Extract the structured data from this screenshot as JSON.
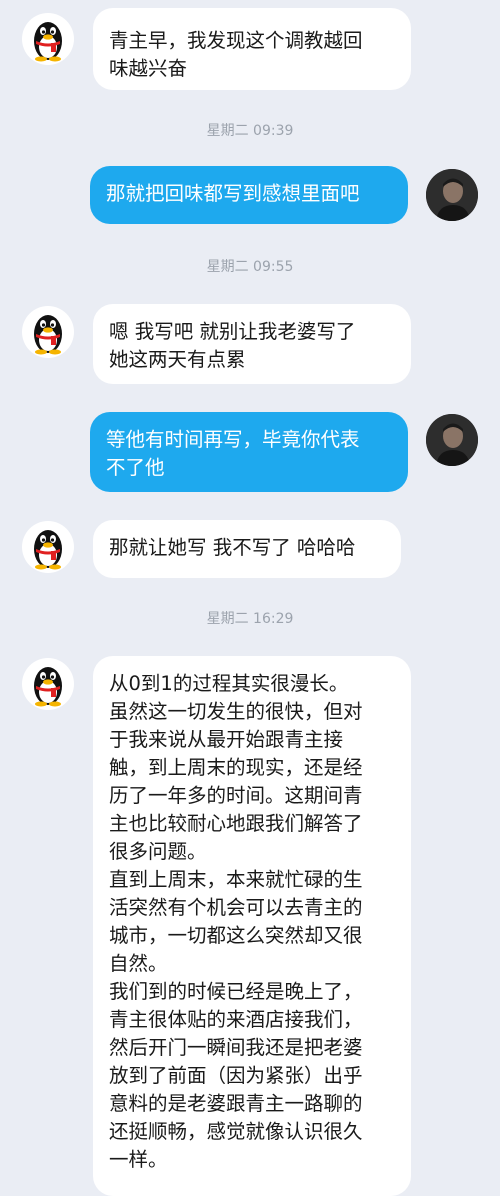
{
  "colors": {
    "background": "#eaedf4",
    "incoming_bubble": "#ffffff",
    "outgoing_bubble": "#1ea9ee",
    "timestamp": "#9ca3ad"
  },
  "messages": [
    {
      "type": "msg",
      "dir": "in",
      "avatar": "qq-penguin-icon",
      "lines": [
        "青主早，我发现这个调教越回",
        "味越兴奋"
      ]
    },
    {
      "type": "ts",
      "text": "星期二 09:39"
    },
    {
      "type": "msg",
      "dir": "out",
      "avatar": "user-avatar",
      "lines": [
        "那就把回味都写到感想里面吧"
      ]
    },
    {
      "type": "ts",
      "text": "星期二 09:55"
    },
    {
      "type": "msg",
      "dir": "in",
      "avatar": "qq-penguin-icon",
      "lines": [
        "嗯 我写吧 就别让我老婆写了",
        "她这两天有点累"
      ]
    },
    {
      "type": "msg",
      "dir": "out",
      "avatar": "user-avatar",
      "lines": [
        "等他有时间再写，毕竟你代表",
        "不了他"
      ]
    },
    {
      "type": "msg",
      "dir": "in",
      "avatar": "qq-penguin-icon",
      "lines": [
        "那就让她写 我不写了 哈哈哈"
      ]
    },
    {
      "type": "ts",
      "text": "星期二 16:29"
    },
    {
      "type": "msg",
      "dir": "in",
      "avatar": "qq-penguin-icon",
      "lines": [
        "从0到1的过程其实很漫长。",
        "虽然这一切发生的很快，但对",
        "于我来说从最开始跟青主接",
        "触，到上周末的现实，还是经",
        "历了一年多的时间。这期间青",
        "主也比较耐心地跟我们解答了",
        "很多问题。",
        "直到上周末，本来就忙碌的生",
        "活突然有个机会可以去青主的",
        "城市，一切都这么突然却又很",
        "自然。",
        "我们到的时候已经是晚上了，",
        "青主很体贴的来酒店接我们，",
        "然后开门一瞬间我还是把老婆",
        "放到了前面（因为紧张）出乎",
        "意料的是老婆跟青主一路聊的",
        "还挺顺畅，感觉就像认识很久",
        "一样。"
      ]
    }
  ]
}
